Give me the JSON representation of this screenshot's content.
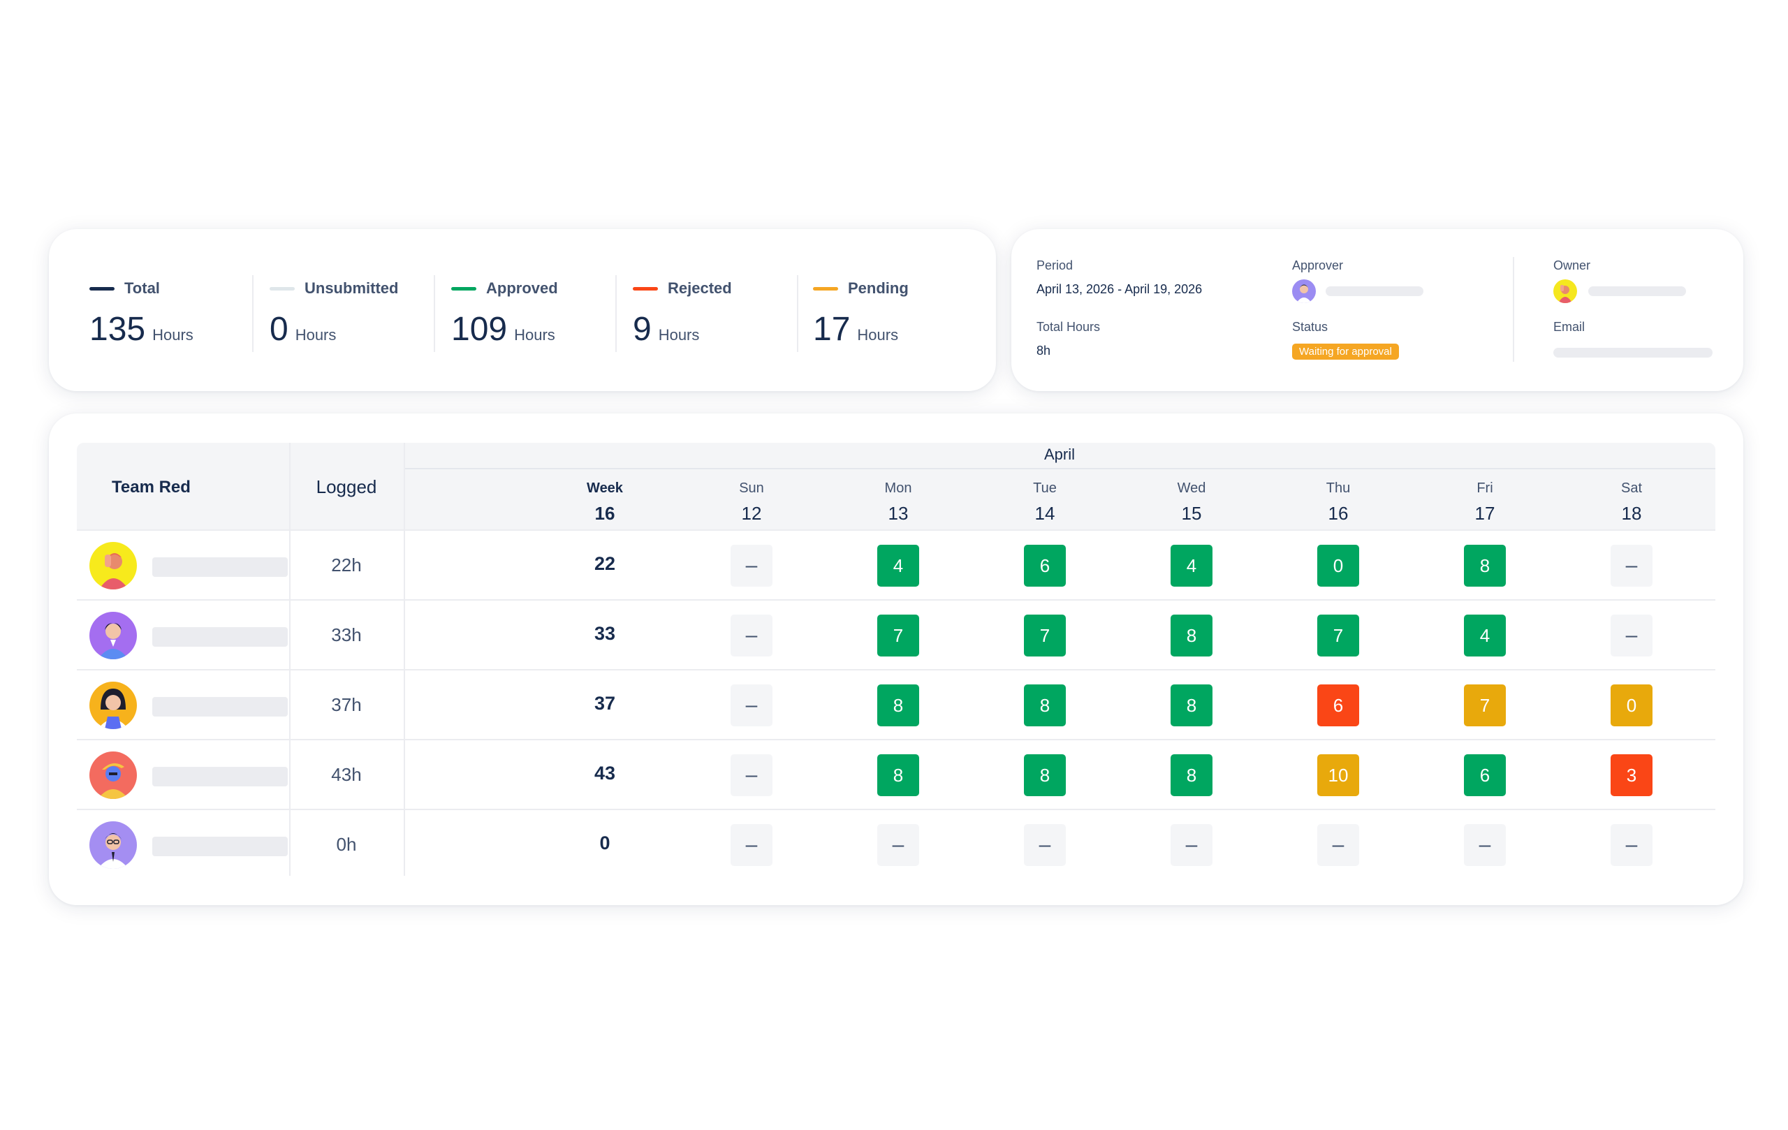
{
  "summary": {
    "stats": [
      {
        "label": "Total",
        "value": "135",
        "unit": "Hours",
        "color": "#172b4d"
      },
      {
        "label": "Unsubmitted",
        "value": "0",
        "unit": "Hours",
        "color": "#dfe6ea"
      },
      {
        "label": "Approved",
        "value": "109",
        "unit": "Hours",
        "color": "#00a660"
      },
      {
        "label": "Rejected",
        "value": "9",
        "unit": "Hours",
        "color": "#fa4616"
      },
      {
        "label": "Pending",
        "value": "17",
        "unit": "Hours",
        "color": "#f5a623"
      }
    ]
  },
  "details": {
    "period_label": "Period",
    "period_value": "April 13, 2026 - April 19, 2026",
    "total_hours_label": "Total Hours",
    "total_hours_value": "8h",
    "approver_label": "Approver",
    "status_label": "Status",
    "status_value": "Waiting for approval",
    "owner_label": "Owner",
    "email_label": "Email"
  },
  "timesheet": {
    "team": "Team Red",
    "logged_header": "Logged",
    "month": "April",
    "week_label": "Week",
    "week_number": "16",
    "days": [
      {
        "name": "Sun",
        "num": "12"
      },
      {
        "name": "Mon",
        "num": "13"
      },
      {
        "name": "Tue",
        "num": "14"
      },
      {
        "name": "Wed",
        "num": "15"
      },
      {
        "name": "Thu",
        "num": "16"
      },
      {
        "name": "Fri",
        "num": "17"
      },
      {
        "name": "Sat",
        "num": "18"
      }
    ],
    "rows": [
      {
        "avatar": "yellow-avatar",
        "logged": "22h",
        "week": "22",
        "cells": [
          {
            "v": "–",
            "s": "empty"
          },
          {
            "v": "4",
            "s": "green"
          },
          {
            "v": "6",
            "s": "green"
          },
          {
            "v": "4",
            "s": "green"
          },
          {
            "v": "0",
            "s": "green"
          },
          {
            "v": "8",
            "s": "green"
          },
          {
            "v": "–",
            "s": "empty"
          }
        ]
      },
      {
        "avatar": "purple-avatar",
        "logged": "33h",
        "week": "33",
        "cells": [
          {
            "v": "–",
            "s": "empty"
          },
          {
            "v": "7",
            "s": "green"
          },
          {
            "v": "7",
            "s": "green"
          },
          {
            "v": "8",
            "s": "green"
          },
          {
            "v": "7",
            "s": "green"
          },
          {
            "v": "4",
            "s": "green"
          },
          {
            "v": "–",
            "s": "empty"
          }
        ]
      },
      {
        "avatar": "orange-avatar",
        "logged": "37h",
        "week": "37",
        "cells": [
          {
            "v": "–",
            "s": "empty"
          },
          {
            "v": "8",
            "s": "green"
          },
          {
            "v": "8",
            "s": "green"
          },
          {
            "v": "8",
            "s": "green"
          },
          {
            "v": "6",
            "s": "red"
          },
          {
            "v": "7",
            "s": "amber"
          },
          {
            "v": "0",
            "s": "amber"
          }
        ]
      },
      {
        "avatar": "coral-avatar",
        "logged": "43h",
        "week": "43",
        "cells": [
          {
            "v": "–",
            "s": "empty"
          },
          {
            "v": "8",
            "s": "green"
          },
          {
            "v": "8",
            "s": "green"
          },
          {
            "v": "8",
            "s": "green"
          },
          {
            "v": "10",
            "s": "amber"
          },
          {
            "v": "6",
            "s": "green"
          },
          {
            "v": "3",
            "s": "red"
          }
        ]
      },
      {
        "avatar": "lavender-avatar",
        "logged": "0h",
        "week": "0",
        "cells": [
          {
            "v": "–",
            "s": "empty"
          },
          {
            "v": "–",
            "s": "empty"
          },
          {
            "v": "–",
            "s": "empty"
          },
          {
            "v": "–",
            "s": "empty"
          },
          {
            "v": "–",
            "s": "empty"
          },
          {
            "v": "–",
            "s": "empty"
          },
          {
            "v": "–",
            "s": "empty"
          }
        ]
      }
    ]
  }
}
